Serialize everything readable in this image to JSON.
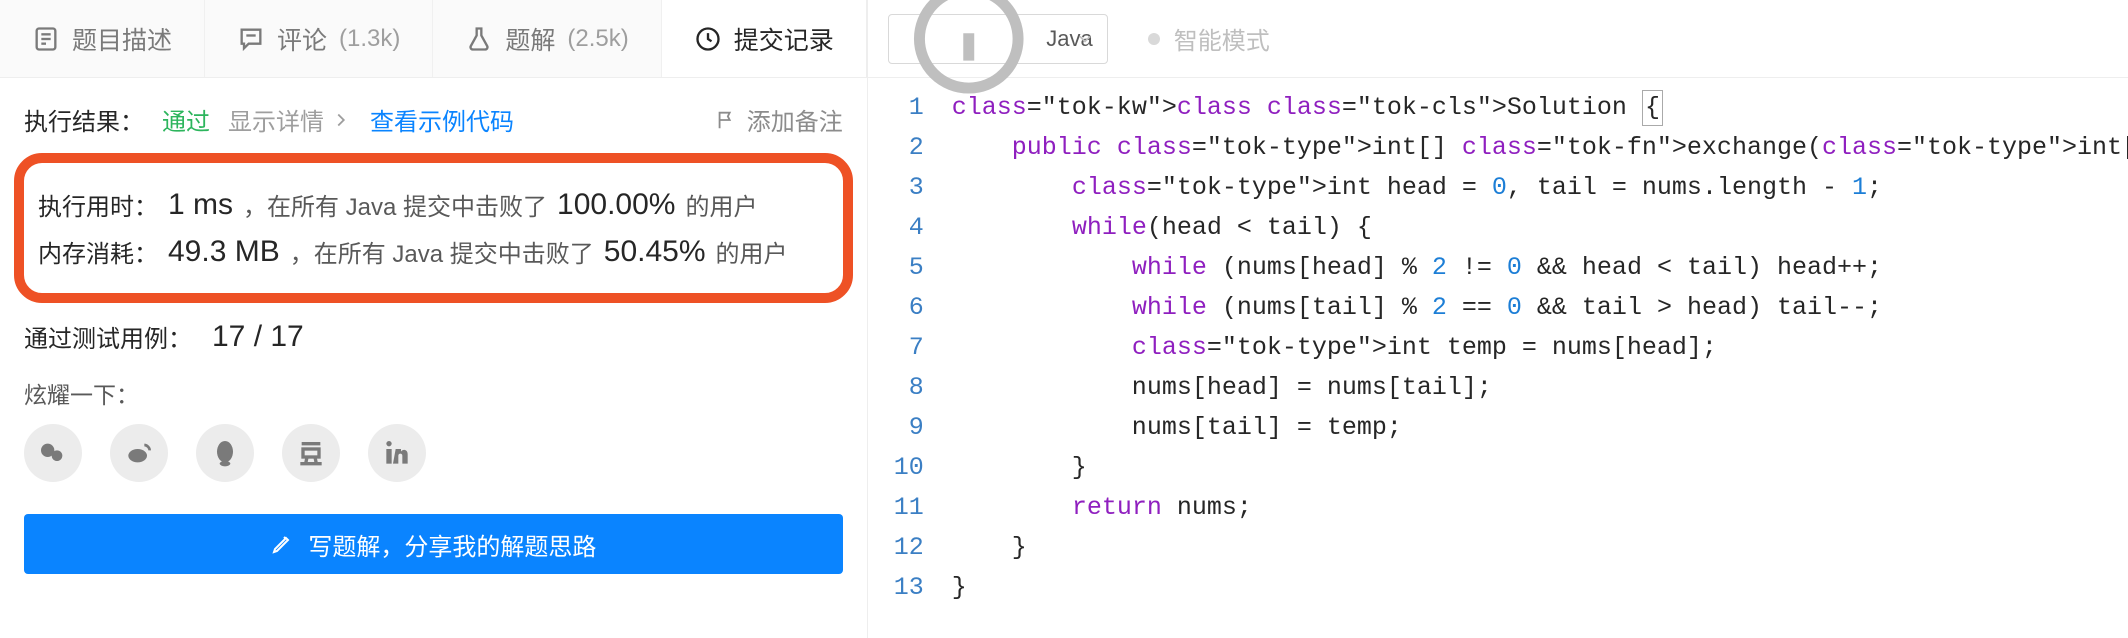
{
  "tabs": {
    "description": {
      "label": "题目描述"
    },
    "comments": {
      "label": "评论",
      "count": "(1.3k)"
    },
    "solutions": {
      "label": "题解",
      "count": "(2.5k)"
    },
    "submissions": {
      "label": "提交记录"
    }
  },
  "result": {
    "label": "执行结果：",
    "status": "通过",
    "show_detail": "显示详情",
    "view_sample": "查看示例代码",
    "add_note": "添加备注"
  },
  "stats": {
    "time": {
      "label": "执行用时：",
      "value": "1 ms",
      "mid": "，在所有 Java 提交中击败了",
      "pct": "100.00%",
      "tail": "的用户"
    },
    "mem": {
      "label": "内存消耗：",
      "value": "49.3 MB",
      "mid": "，在所有 Java 提交中击败了",
      "pct": "50.45%",
      "tail": "的用户"
    }
  },
  "cases": {
    "label": "通过测试用例：",
    "value": "17 / 17"
  },
  "share": {
    "label": "炫耀一下："
  },
  "write_button": "写题解，分享我的解题思路",
  "editor": {
    "language": "Java",
    "smart_mode": "智能模式",
    "code_lines": [
      "class Solution {",
      "    public int[] exchange(int[] nums) {",
      "        int head = 0, tail = nums.length - 1;",
      "        while(head < tail) {",
      "            while (nums[head] % 2 != 0 && head < tail) head++;",
      "            while (nums[tail] % 2 == 0 && tail > head) tail--;",
      "            int temp = nums[head];",
      "            nums[head] = nums[tail];",
      "            nums[tail] = temp;",
      "        }",
      "        return nums;",
      "    }",
      "}"
    ]
  }
}
